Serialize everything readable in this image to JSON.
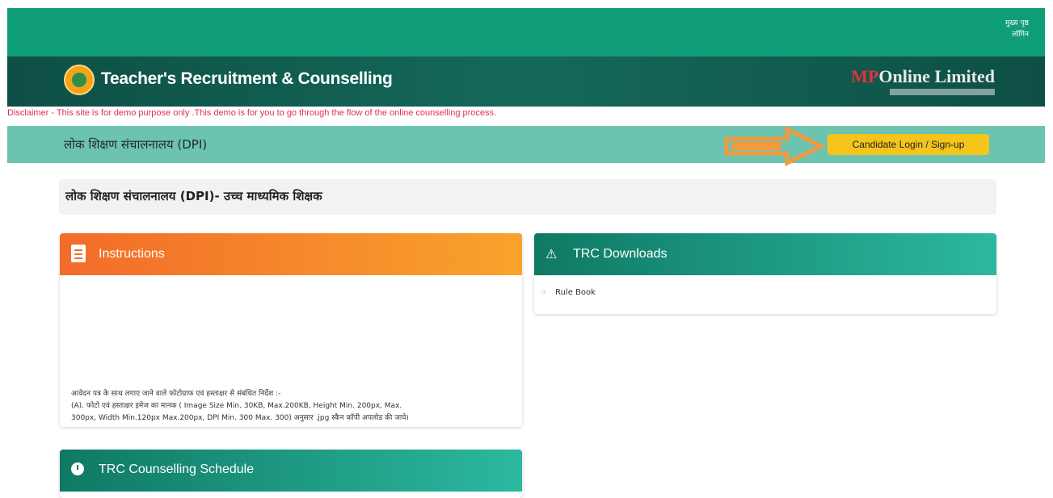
{
  "topbar": {
    "link_line1": "मुख्य पृष्ठ",
    "link_line2": "लॉगिन"
  },
  "brand": {
    "title": "Teacher's Recruitment & Counselling",
    "partner_mp": "MP",
    "partner_rest": "Online Limited"
  },
  "disclaimer": "Disclaimer - This site is for demo purpose only .This demo is for you to go through the flow of the online counselling process.",
  "dpi_bar": {
    "label": "लोक शिक्षण संचालनालय (DPI)",
    "login_button": "Candidate Login / Sign-up"
  },
  "section": {
    "title": "लोक शिक्षण संचालनालय (DPI)- उच्च माध्यमिक शिक्षक"
  },
  "instructions": {
    "title": "Instructions",
    "line1": "आवेदन पत्र के साथ लगाए जाने वाले फोटोग्राफ एवं हस्ताक्षर से संबंधित निर्देश :-",
    "line2": "(A). फोटो एवं हस्ताक्षर इमेज का मानक ( Image Size Min. 30KB, Max.200KB, Height Min. 200px, Max.",
    "line3": "300px, Width Min.120px Max.200px, DPI Min. 300 Max. 300) अनुसार .jpg स्कैन कॉपी अपलोड की जाये।"
  },
  "downloads": {
    "title": "TRC Downloads",
    "items": [
      {
        "label": "Rule Book"
      }
    ]
  },
  "schedule": {
    "title": "TRC Counselling Schedule"
  },
  "colors": {
    "topbar": "#0f9e77",
    "brand": "#0e4f45",
    "dpi_bar": "#6cc3b0",
    "login_button": "#f5c51c",
    "instructions_head": "#f36b2a",
    "teal_head": "#0f7964",
    "arrow": "#f39a3d"
  }
}
